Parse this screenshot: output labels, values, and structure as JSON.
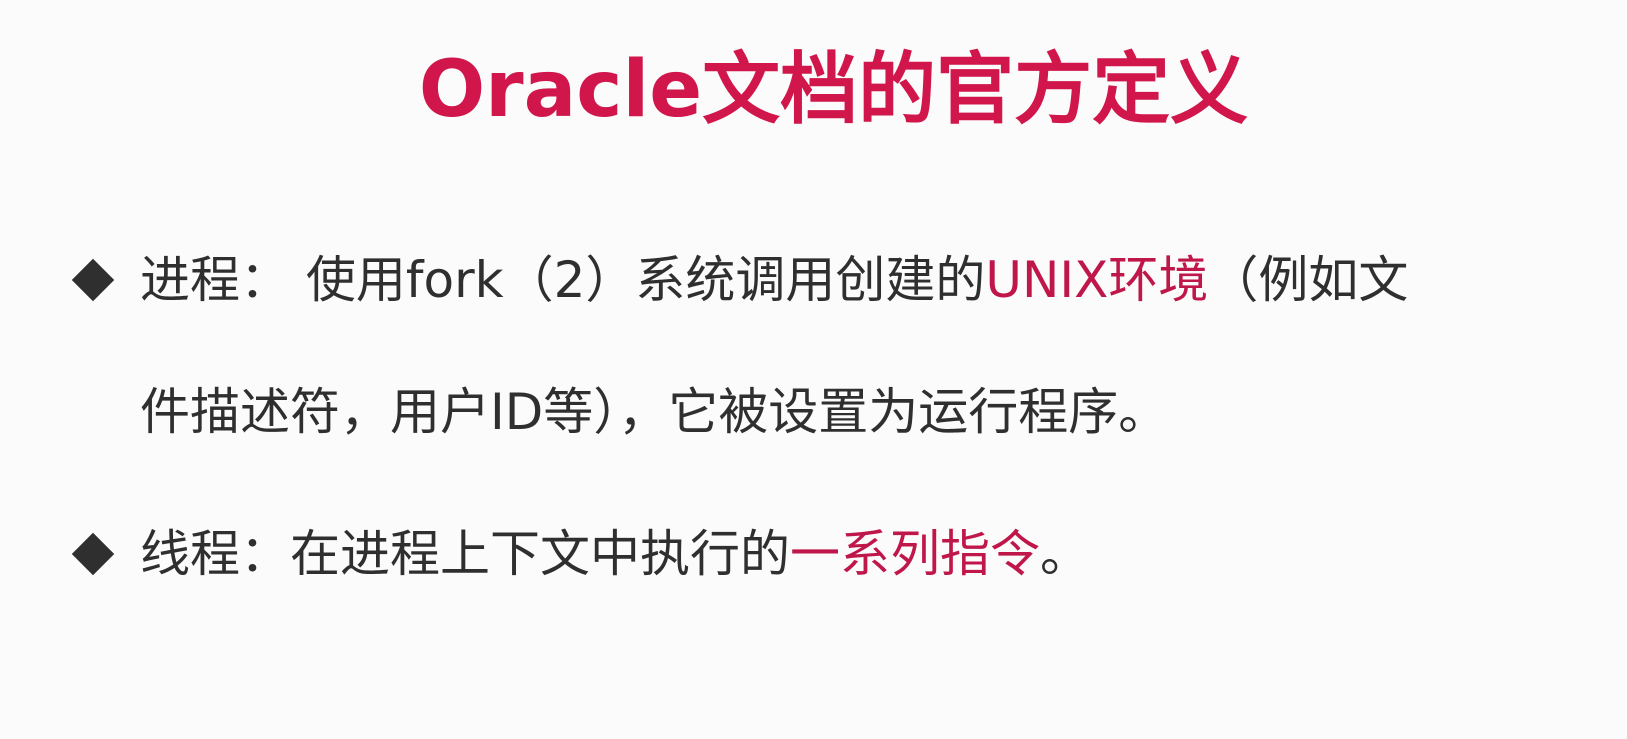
{
  "title": "Oracle文档的官方定义",
  "bullets": [
    {
      "line1_a": "进程： 使用fork（2）系统调用创建的",
      "line1_hl": "UNIX环境",
      "line1_b": "（例如文",
      "line2": "件描述符，用户ID等），它被设置为运行程序。"
    },
    {
      "a": "线程：在进程上下文中执行的",
      "hl": "一系列指令",
      "b": "。"
    }
  ],
  "colors": {
    "accent": "#d0164a",
    "text": "#2f2f2f",
    "background": "#fbfbfb"
  },
  "icons": {
    "bullet_marker": "diamond-bullet-icon"
  }
}
